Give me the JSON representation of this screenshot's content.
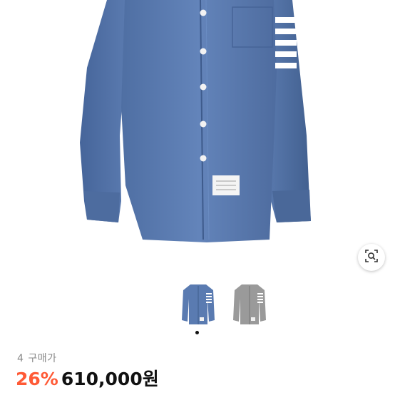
{
  "product": {
    "purchase_count": "4",
    "purchase_label": "구매가",
    "discount": "26%",
    "price": "610,000원"
  },
  "colors": {
    "accent": "#ff5a36",
    "chambray": "#5c7db0",
    "stripe": "#ffffff",
    "gray_variant": "#9a9a9a"
  },
  "icons": {
    "lens": "lens-search-icon",
    "pager": "pager-dot"
  },
  "gallery": {
    "thumbnail_count": 2,
    "selected_index": 0
  }
}
